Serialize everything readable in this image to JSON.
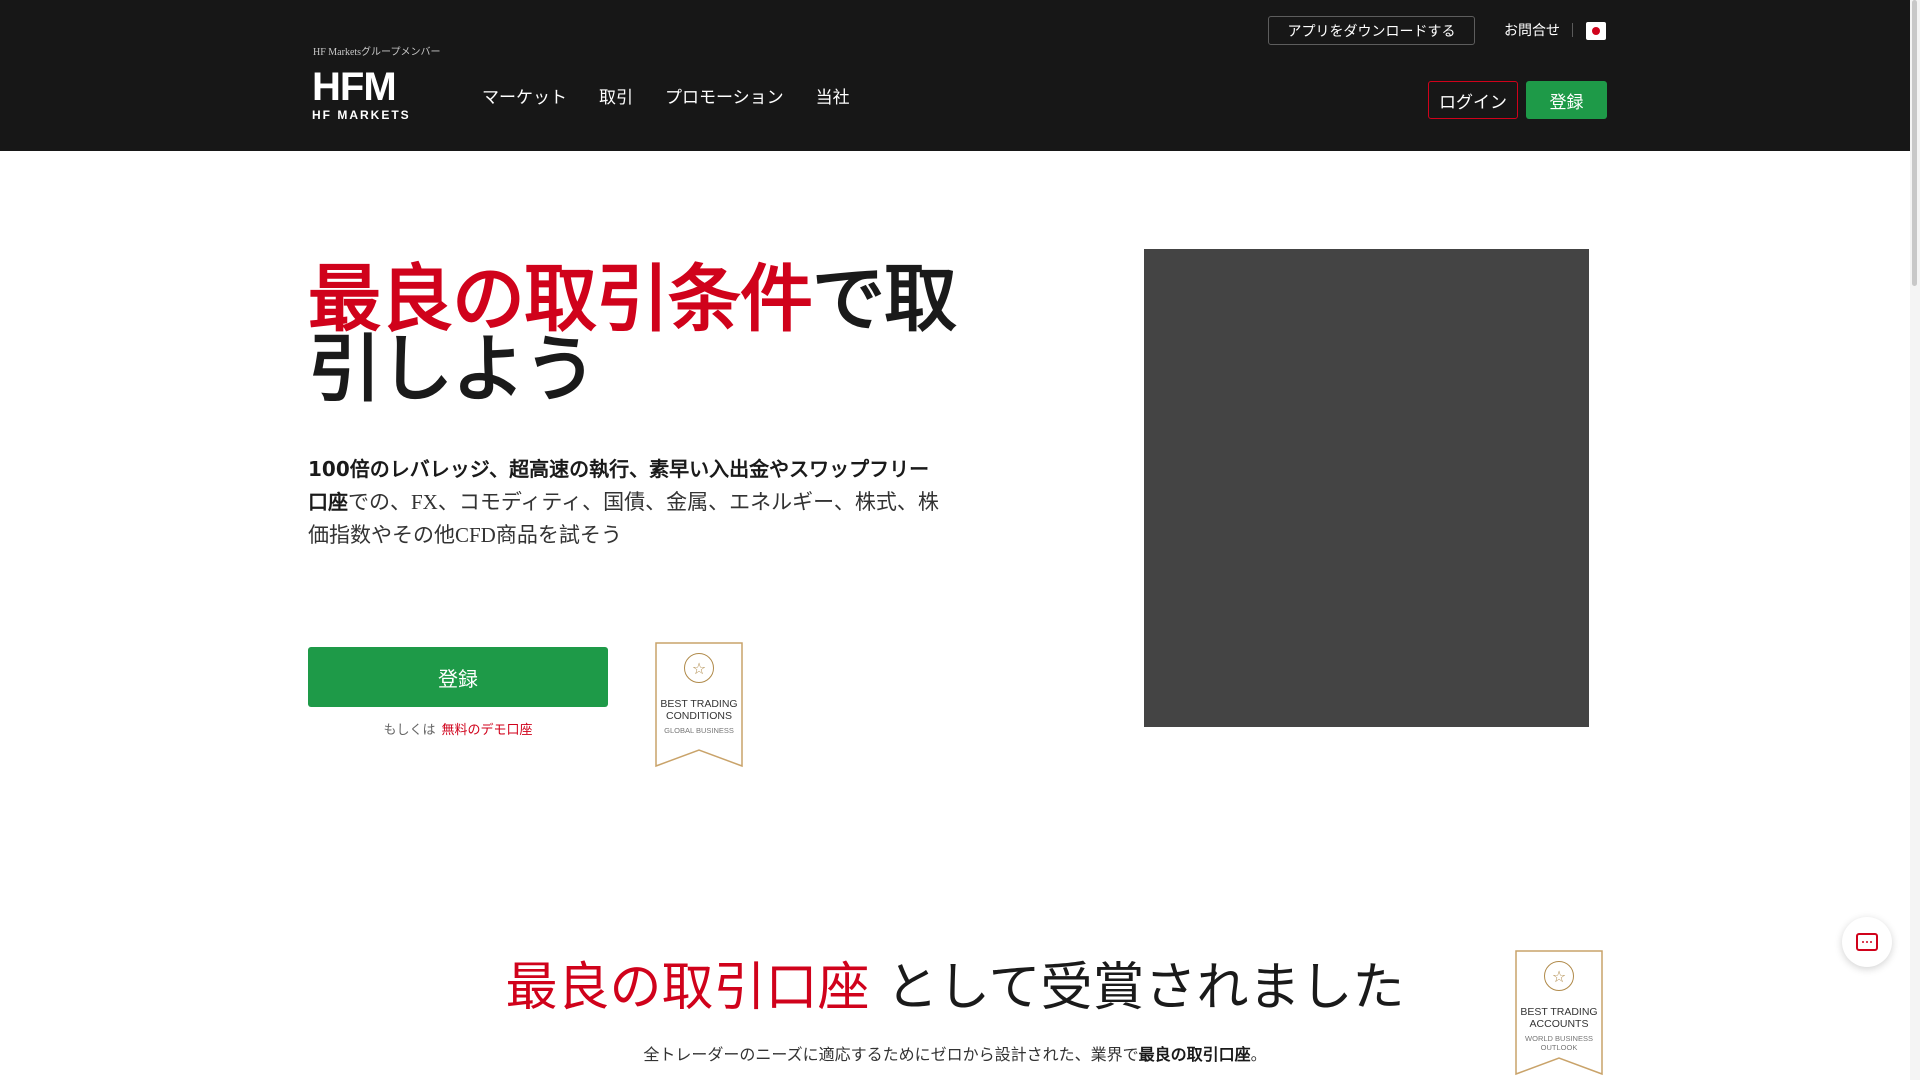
{
  "header": {
    "group_label": "HF Marketsグループメンバー",
    "logo_main": "HFM",
    "logo_sub": "HF MARKETS",
    "nav": [
      "マーケット",
      "取引",
      "プロモーション",
      "当社"
    ],
    "app_download": "アプリをダウンロードする",
    "contact": "お問合せ",
    "login": "ログイン",
    "signup": "登録",
    "language_flag_icon": "japan-flag-icon"
  },
  "hero": {
    "title_red": "最良の取引条件",
    "title_rest": "で取引しよう",
    "desc_bold": "100倍のレバレッジ、超高速の執行、素早い入出金やスワップフリー口座",
    "desc_rest": "での、FX、コモディティ、国債、金属、エネルギー、株式、株価指数やその他CFD商品を試そう",
    "signup_button": "登録",
    "or_text": "もしくは",
    "demo_link": "無料のデモ口座",
    "award": {
      "line1": "BEST TRADING CONDITIONS",
      "line2": "GLOBAL BUSINESS"
    }
  },
  "section2": {
    "title_red": "最良の取引口座",
    "title_rest": " として受賞されました",
    "desc_pre": "全トレーダーのニーズに適応するためにゼロから設計された、業界で",
    "desc_bold": "最良の取引口座",
    "desc_post": "。",
    "award": {
      "line1": "BEST TRADING ACCOUNTS",
      "line2": "WORLD BUSINESS OUTLOOK"
    }
  },
  "colors": {
    "brand_red": "#d0021b",
    "brand_green": "#1e9a48",
    "header_bg": "#171717",
    "video_bg": "#444444"
  }
}
